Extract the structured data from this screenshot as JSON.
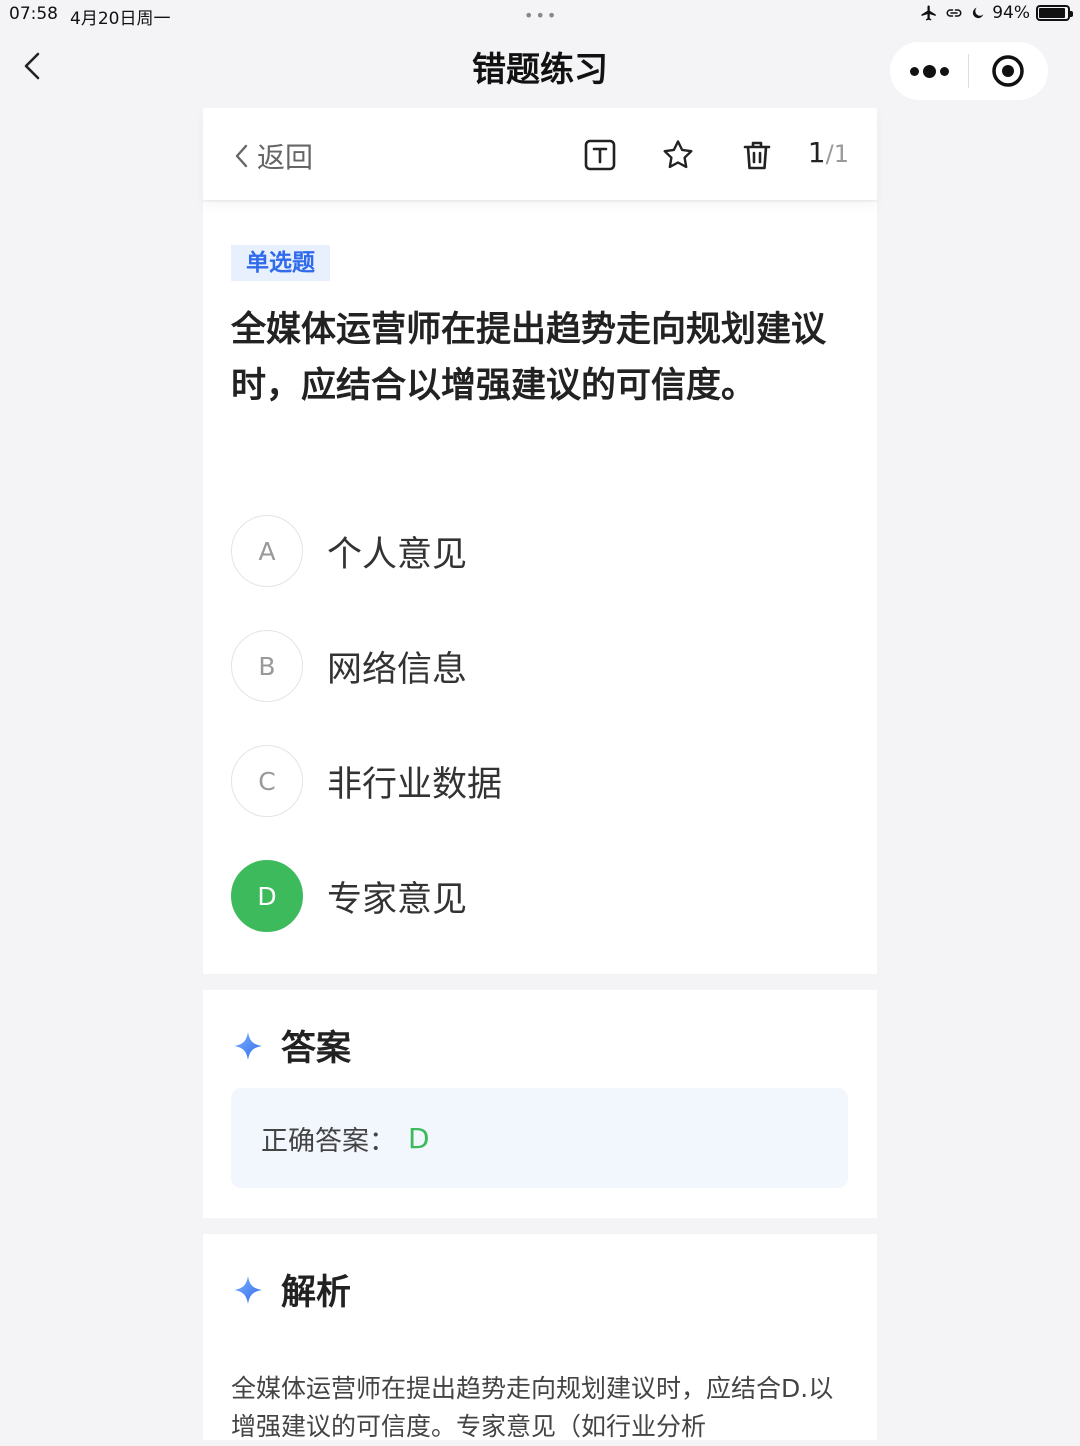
{
  "status_bar": {
    "time": "07:58",
    "date": "4月20日周一",
    "battery": "94%",
    "battery_level": 0.94
  },
  "navbar": {
    "title": "错题练习"
  },
  "toolbar": {
    "back_label": "返回",
    "counter_current": "1",
    "counter_sep": "/",
    "counter_total": "1"
  },
  "question": {
    "type_tag": "单选题",
    "text": "全媒体运营师在提出趋势走向规划建议时，应结合以增强建议的可信度。",
    "options": [
      {
        "letter": "A",
        "text": "个人意见",
        "correct": false
      },
      {
        "letter": "B",
        "text": "网络信息",
        "correct": false
      },
      {
        "letter": "C",
        "text": "非行业数据",
        "correct": false
      },
      {
        "letter": "D",
        "text": "专家意见",
        "correct": true
      }
    ]
  },
  "answer": {
    "title": "答案",
    "label": "正确答案：",
    "value": "D"
  },
  "analysis": {
    "title": "解析",
    "text": "全媒体运营师在提出趋势走向规划建议时，应结合D.以增强建议的可信度。专家意见（如行业分析"
  },
  "colors": {
    "accent_blue": "#2f6bea",
    "correct_green": "#3dbb5c",
    "tag_bg": "#e8effd",
    "answer_bg": "#f2f6fd",
    "page_bg": "#f4f4f6"
  }
}
